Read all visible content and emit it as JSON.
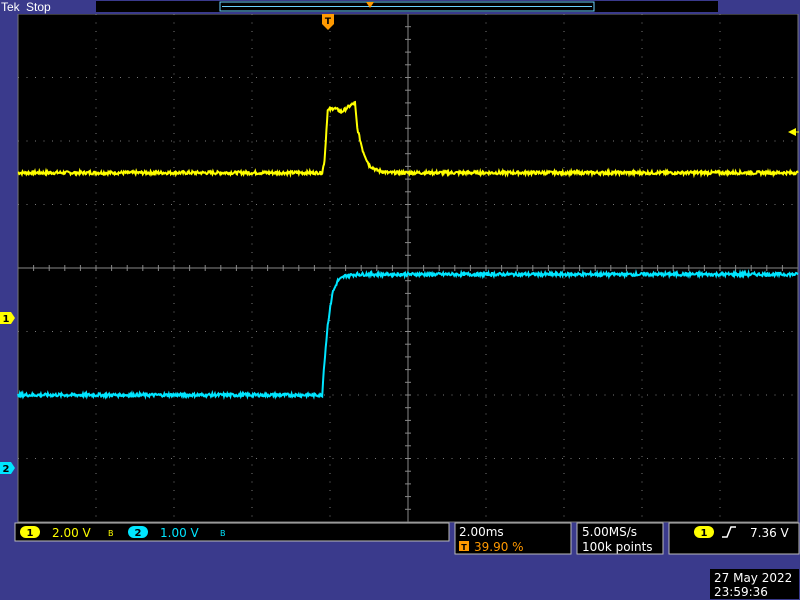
{
  "header": {
    "brand": "Tek",
    "run_state": "Stop"
  },
  "channels": [
    {
      "id": "1",
      "scale": "2.00 V",
      "coupling_icon": "bandwidth-limit-icon",
      "color": "#ffff00"
    },
    {
      "id": "2",
      "scale": "1.00 V",
      "coupling_icon": "bandwidth-limit-icon",
      "color": "#00e5ff"
    }
  ],
  "timebase": {
    "scale": "2.00ms",
    "trigger_position": "39.90 %",
    "trigger_marker": "T"
  },
  "acquisition": {
    "sample_rate": "5.00MS/s",
    "record_length": "100k points"
  },
  "trigger": {
    "source": "1",
    "slope_icon": "rising-edge-icon",
    "level": "7.36 V"
  },
  "timestamp": {
    "date": "27 May 2022",
    "time": "23:59:36"
  },
  "chart_data": {
    "type": "line",
    "grid": true,
    "x_units": "divisions",
    "y_units": "divisions",
    "xlim": [
      0,
      10
    ],
    "ylim": [
      -4,
      4
    ],
    "series": [
      {
        "name": "1",
        "color": "#ffff00",
        "x": [
          0,
          3.9,
          3.93,
          3.97,
          4.05,
          4.15,
          4.25,
          4.32,
          4.35,
          4.42,
          4.5,
          4.6,
          4.75,
          10
        ],
        "y": [
          1.5,
          1.5,
          1.7,
          2.48,
          2.52,
          2.46,
          2.55,
          2.6,
          2.2,
          1.85,
          1.62,
          1.54,
          1.5,
          1.5
        ]
      },
      {
        "name": "2",
        "color": "#00e5ff",
        "x": [
          0,
          3.9,
          3.92,
          3.97,
          4.03,
          4.1,
          4.2,
          4.35,
          10
        ],
        "y": [
          -2.0,
          -2.0,
          -1.6,
          -0.9,
          -0.4,
          -0.2,
          -0.12,
          -0.1,
          -0.1
        ]
      }
    ]
  }
}
